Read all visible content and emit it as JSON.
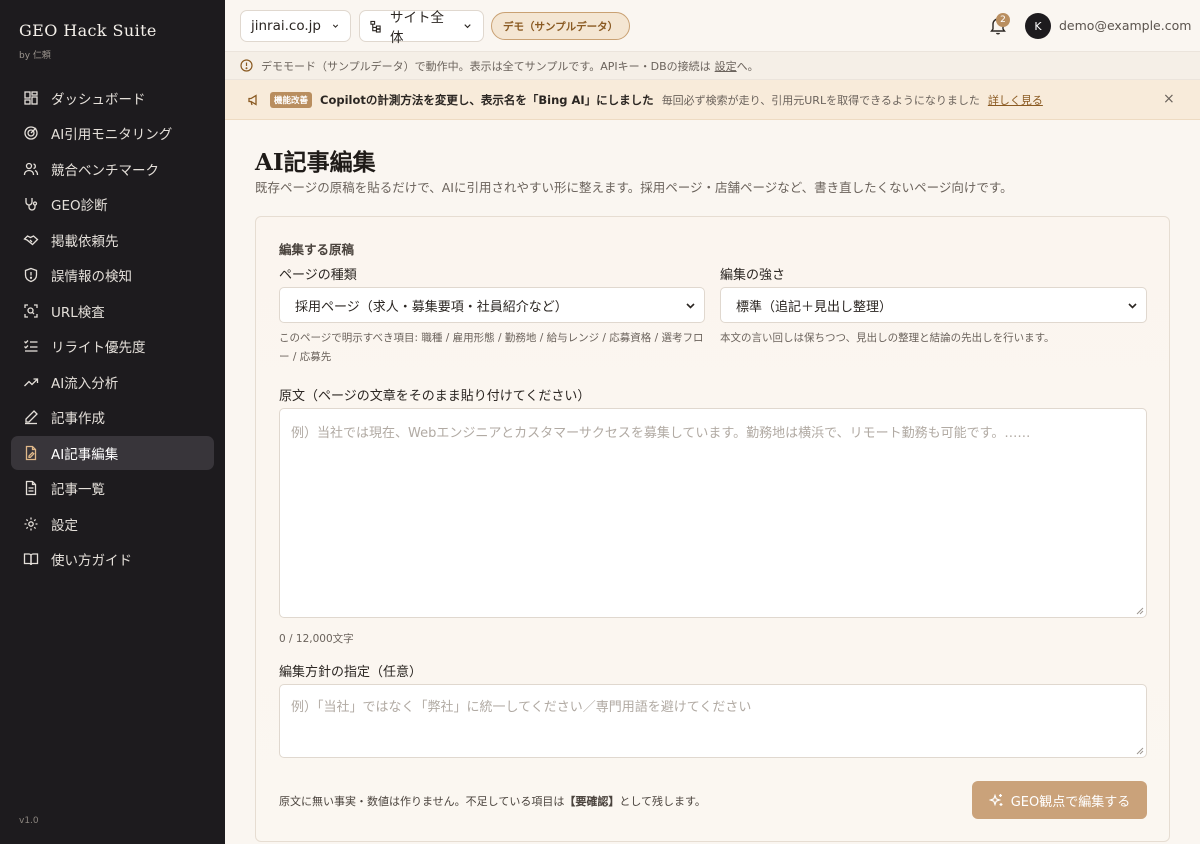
{
  "brand": {
    "title": "GEO Hack Suite",
    "subtitle": "by 仁頼"
  },
  "sidebar": {
    "items": [
      {
        "label": "ダッシュボード",
        "icon": "grid-icon"
      },
      {
        "label": "AI引用モニタリング",
        "icon": "radar-icon"
      },
      {
        "label": "競合ベンチマーク",
        "icon": "users-icon"
      },
      {
        "label": "GEO診断",
        "icon": "stethoscope-icon"
      },
      {
        "label": "掲載依頼先",
        "icon": "handshake-icon"
      },
      {
        "label": "誤情報の検知",
        "icon": "shield-alert-icon"
      },
      {
        "label": "URL検査",
        "icon": "scan-icon"
      },
      {
        "label": "リライト優先度",
        "icon": "list-checks-icon"
      },
      {
        "label": "AI流入分析",
        "icon": "trending-up-icon"
      },
      {
        "label": "記事作成",
        "icon": "pen-icon"
      },
      {
        "label": "AI記事編集",
        "icon": "file-edit-icon",
        "active": true
      },
      {
        "label": "記事一覧",
        "icon": "file-text-icon"
      },
      {
        "label": "設定",
        "icon": "gear-icon"
      },
      {
        "label": "使い方ガイド",
        "icon": "book-icon"
      }
    ],
    "version": "v1.0"
  },
  "topbar": {
    "site": "jinrai.co.jp",
    "scope": "サイト全体",
    "demo_badge": "デモ（サンプルデータ）",
    "notification_count": "2",
    "avatar_initial": "K",
    "email": "demo@example.com"
  },
  "notice": {
    "text": "デモモード（サンプルデータ）で動作中。表示は全てサンプルです。APIキー・DBの接続は",
    "link": "設定",
    "suffix": "へ。"
  },
  "announcement": {
    "tag": "機能改善",
    "title": "Copilotの計測方法を変更し、表示名を「Bing AI」にしました",
    "description": "毎回必ず検索が走り、引用元URLを取得できるようになりました",
    "link": "詳しく見る",
    "close": "×"
  },
  "page": {
    "title": "AI記事編集",
    "description": "既存ページの原稿を貼るだけで、AIに引用されやすい形に整えます。採用ページ・店舗ページなど、書き直したくないページ向けです。"
  },
  "form": {
    "section_label": "編集する原稿",
    "page_type_label": "ページの種類",
    "page_type_value": "採用ページ（求人・募集要項・社員紹介など）",
    "page_type_hint": "このページで明示すべき項目: 職種 / 雇用形態 / 勤務地 / 給与レンジ / 応募資格 / 選考フロー / 応募先",
    "strength_label": "編集の強さ",
    "strength_value": "標準（追記＋見出し整理）",
    "strength_hint": "本文の言い回しは保ちつつ、見出しの整理と結論の先出しを行います。",
    "source_label": "原文（ページの文章をそのまま貼り付けてください）",
    "source_placeholder": "例）当社では現在、Webエンジニアとカスタマーサクセスを募集しています。勤務地は横浜で、リモート勤務も可能です。……",
    "counter": "0 / 12,000文字",
    "policy_label": "編集方針の指定（任意）",
    "policy_placeholder": "例）「当社」ではなく「弊社」に統一してください／専門用語を避けてください",
    "footer_note_prefix": "原文に無い事実・数値は作りません。不足している項目は",
    "footer_note_bold": "【要確認】",
    "footer_note_suffix": "として残します。",
    "submit_label": "GEO観点で編集する"
  }
}
